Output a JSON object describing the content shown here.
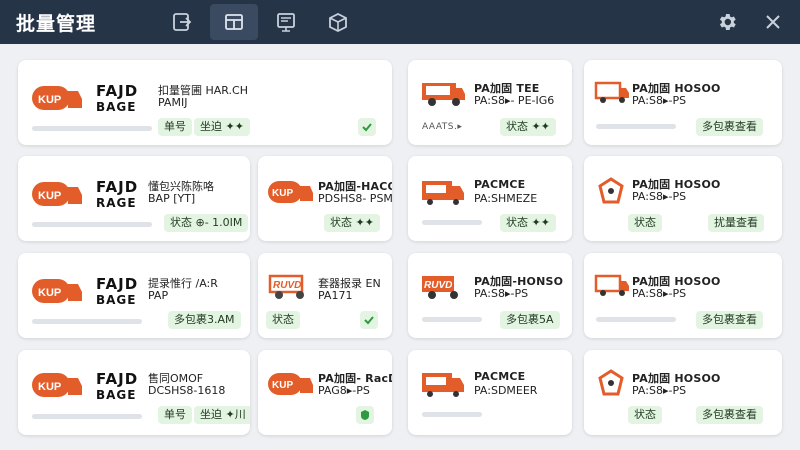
{
  "window": {
    "title": "批量管理"
  },
  "colors": {
    "titlebar": "#263448",
    "accent": "#e25d2a",
    "badge_bg": "#e3f4e2",
    "check": "#2e9b3e"
  },
  "icons": {
    "toolbar": [
      "export-icon",
      "layout-icon",
      "list-icon",
      "box-icon"
    ],
    "controls": [
      "gear-icon",
      "close-icon"
    ]
  },
  "cards": {
    "r0c0": {
      "big1": "FAJD",
      "big2": "BAGE",
      "name1": "扣量管圃 HAR.CH",
      "name2": "PAMIJ",
      "badge1": "单号",
      "badge2": "坐迫 ✦✦"
    },
    "r0c2": {
      "name1": "PA加固 TEE",
      "name2": "PA:S8▸- PE-IG6",
      "meta": "AAATS.▸",
      "badge1": "状态 ✦✦"
    },
    "r0c3": {
      "name1": "PA加固 HOSOO",
      "name2": "PA:S8▸-PS",
      "badge1": "多包裹查看"
    },
    "r1c0": {
      "big1": "FAJD",
      "big2": "RAGE",
      "name1": "懂包兴陈陈咯",
      "name2": "BAP [YT]",
      "badge1": "状态 ⊕- 1.0IM"
    },
    "r1c1": {
      "name1": "PA加固-HACO",
      "name2": "PDSHS8- PSM",
      "badge1": "状态 ✦✦"
    },
    "r1c2": {
      "name1": "PACMCE",
      "name2": "PA:SHMEZE",
      "badge1": "状态 ✦✦"
    },
    "r1c3": {
      "name1": "PA加固 HOSOO",
      "name2": "PA:S8▸-PS",
      "badge1": "状态",
      "badge2": "扰量查看"
    },
    "r2c0": {
      "big1": "FAJD",
      "big2": "BAGE",
      "name1": "提录惟行 /A:R",
      "name2": "PAP",
      "badge1": "多包裹3.AM"
    },
    "r2c1": {
      "name1": "套器报录 EN",
      "name2": "PA171",
      "badge1": "状态"
    },
    "r2c2": {
      "name1": "PA加固-HONSO",
      "name2": "PA:S8▸-PS",
      "badge1": "多包裹5A"
    },
    "r2c3": {
      "name1": "PA加固 HOSOO",
      "name2": "PA:S8▸-PS",
      "badge1": "多包裹查看"
    },
    "r3c0": {
      "big1": "FAJD",
      "big2": "BAGE",
      "name1": "售同OMOF",
      "name2": "DCSHS8-1618",
      "badge1": "单号",
      "badge2": "坐迫 ✦川"
    },
    "r3c1": {
      "name1": "PA加固- RacD",
      "name2": "PAG8▸-PS",
      "badge1": ""
    },
    "r3c2": {
      "name1": "PACMCE",
      "name2": "PA:SDMEER"
    },
    "r3c3": {
      "name1": "PA加固 HOSOO",
      "name2": "PA:S8▸-PS",
      "badge1": "状态",
      "badge2": "多包裹查看"
    }
  },
  "logos": {
    "kup": "KUP",
    "ruvd": "RUVD"
  }
}
